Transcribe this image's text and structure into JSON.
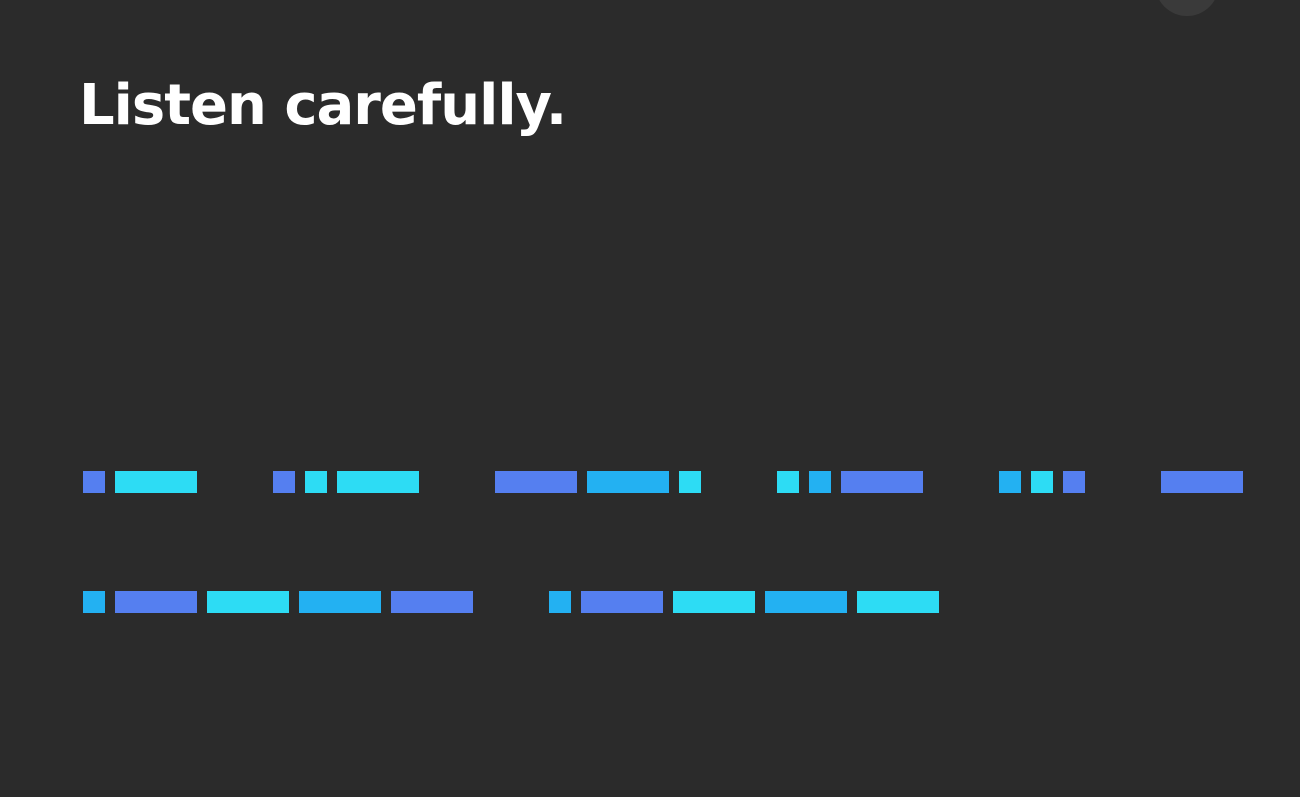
{
  "heading": "Listen carefully.",
  "colors": {
    "background": "#2b2b2b",
    "text": "#ffffff",
    "mark_blue": "#557ff0",
    "mark_cyan": "#2ddcf4",
    "mark_sky": "#23b1f2"
  },
  "morse_code": {
    "rows": [
      {
        "words": [
          [
            {
              "s": "dot",
              "c": "a"
            },
            {
              "s": "dash",
              "c": "b"
            }
          ],
          [
            {
              "s": "dot",
              "c": "a"
            },
            {
              "s": "dot",
              "c": "b"
            },
            {
              "s": "dash",
              "c": "b"
            }
          ],
          [
            {
              "s": "dash",
              "c": "a"
            },
            {
              "s": "dash",
              "c": "c"
            },
            {
              "s": "dot",
              "c": "b"
            }
          ],
          [
            {
              "s": "dot",
              "c": "b"
            },
            {
              "s": "dot",
              "c": "c"
            },
            {
              "s": "dash",
              "c": "a"
            }
          ],
          [
            {
              "s": "dot",
              "c": "c"
            },
            {
              "s": "dot",
              "c": "b"
            },
            {
              "s": "dot",
              "c": "a"
            }
          ],
          [
            {
              "s": "dash",
              "c": "a"
            }
          ]
        ]
      },
      {
        "words": [
          [
            {
              "s": "dot",
              "c": "c"
            },
            {
              "s": "dash",
              "c": "a"
            },
            {
              "s": "dash",
              "c": "b"
            },
            {
              "s": "dash",
              "c": "c"
            },
            {
              "s": "dash",
              "c": "a"
            }
          ],
          [
            {
              "s": "dot",
              "c": "c"
            },
            {
              "s": "dash",
              "c": "a"
            },
            {
              "s": "dash",
              "c": "b"
            },
            {
              "s": "dash",
              "c": "c"
            },
            {
              "s": "dash",
              "c": "b"
            }
          ]
        ]
      }
    ]
  }
}
